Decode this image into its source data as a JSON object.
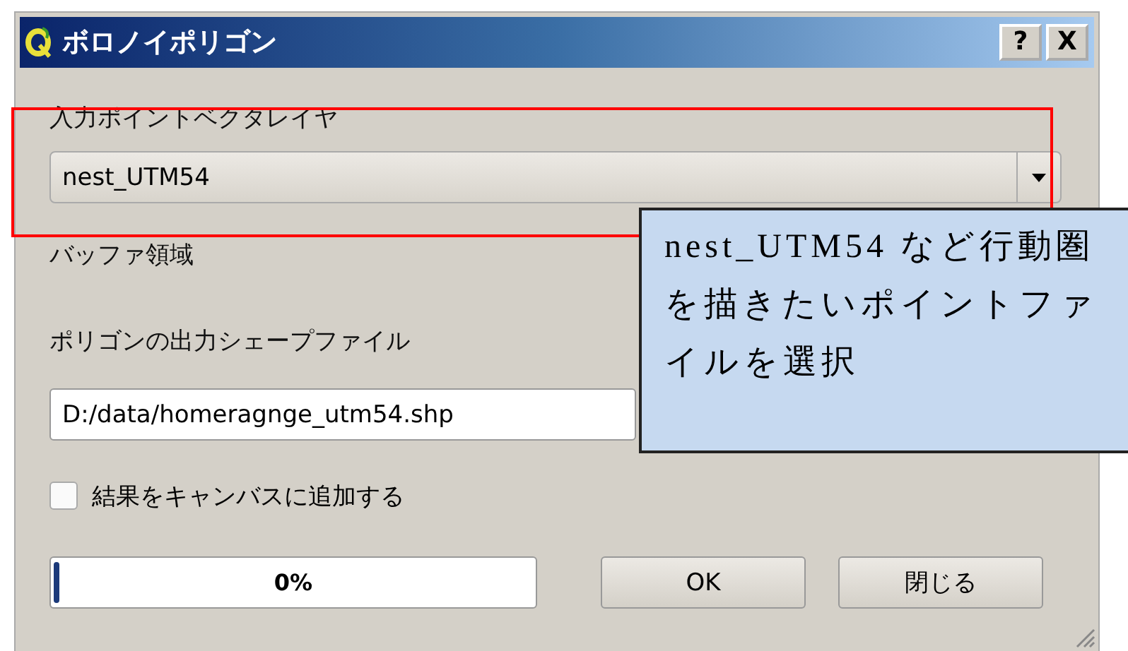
{
  "window": {
    "title": "ボロノイポリゴン",
    "help_button": "?",
    "close_button": "X"
  },
  "input_layer": {
    "label": "入力ポイントベクタレイヤ",
    "value": "nest_UTM54"
  },
  "buffer": {
    "label": "バッファ領域"
  },
  "output": {
    "label": "ポリゴンの出力シェープファイル",
    "value": "D:/data/homeragnge_utm54.shp"
  },
  "add_to_canvas": {
    "label": "結果をキャンバスに追加する",
    "checked": false
  },
  "progress": {
    "level": 0,
    "text": "0%"
  },
  "buttons": [
    {
      "label": "OK"
    },
    {
      "label": "閉じる"
    }
  ],
  "callout": {
    "text": "nest_UTM54 など行動圏を描きたいポイントファイルを選択"
  }
}
